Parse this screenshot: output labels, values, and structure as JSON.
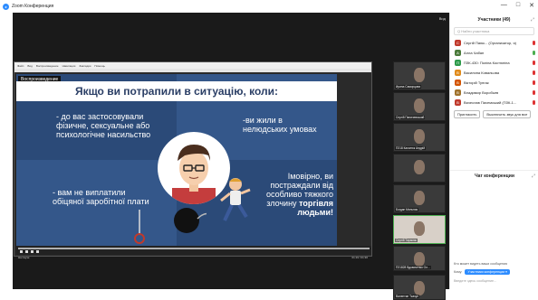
{
  "window": {
    "title": "Zoom Конференция",
    "controls": [
      "—",
      "□",
      "✕"
    ]
  },
  "stage": {
    "view_label": "Вид"
  },
  "shared_app": {
    "menu_items": [
      "Файл",
      "Вид",
      "Воспроизведение",
      "Навигация",
      "Закладки",
      "Помощь"
    ],
    "playback_badge": "Воспроизведение",
    "status_left": "На паузе",
    "status_right": "01:19 / 01:30"
  },
  "slide": {
    "banner": "Якщо ви потрапили в ситуацію, коли:",
    "q1": "- до вас застосовували фізичне, сексуальне або психологічне насильство",
    "q2": "-ви жили в нелюдських умовах",
    "q3": "- вам не виплатили обіцяної заробітної плати",
    "q4_main": "Імовірно, ви постраждали від особливо тяжкого злочину",
    "q4_emph": "торгівля людьми!"
  },
  "filmstrip": {
    "tiles": [
      {
        "label": "Ирина Саморцова"
      },
      {
        "label": "Сергій Паничевський"
      },
      {
        "label": "ПЗ18 Калатюк Андрій"
      },
      {
        "label": ""
      },
      {
        "label": "Богдан Мельник"
      },
      {
        "label": "Сергій Тарасюк"
      },
      {
        "label": "ПЗ1828 Вдовиченко Ол..."
      },
      {
        "label": "Валентин Ткачук"
      }
    ]
  },
  "participants": {
    "header": "Участники (49)",
    "search_placeholder": "Q Найти участника",
    "items": [
      {
        "initial": "С",
        "color": "#c0392b",
        "name": "Сергій Паюк... (Организатор, я)"
      },
      {
        "initial": "А",
        "color": "#4a7a3a",
        "name": "Алла Чабан"
      },
      {
        "initial": "П",
        "color": "#2d9a4a",
        "name": "ПЗК-430: Поліна Костюніна"
      },
      {
        "initial": "В",
        "color": "#e08a1a",
        "name": "Василина Ковальова"
      },
      {
        "initial": "В",
        "color": "#d35400",
        "name": "Вікторій Тунгак"
      },
      {
        "initial": "В",
        "color": "#a0722b",
        "name": "Владимир Воробьев"
      },
      {
        "initial": "В",
        "color": "#c0392b",
        "name": "Вячеслав Писемський (ПЗК-1..."
      }
    ],
    "invite_button": "Пригласить",
    "mute_all_button": "Выключить звук для все"
  },
  "chat": {
    "header": "Чат конференции",
    "notice": "Кто может видеть ваши сообщения",
    "to_label": "Кому:",
    "to_value": "Участники конференции ▾",
    "input_placeholder": "Введите здесь сообщение..."
  }
}
